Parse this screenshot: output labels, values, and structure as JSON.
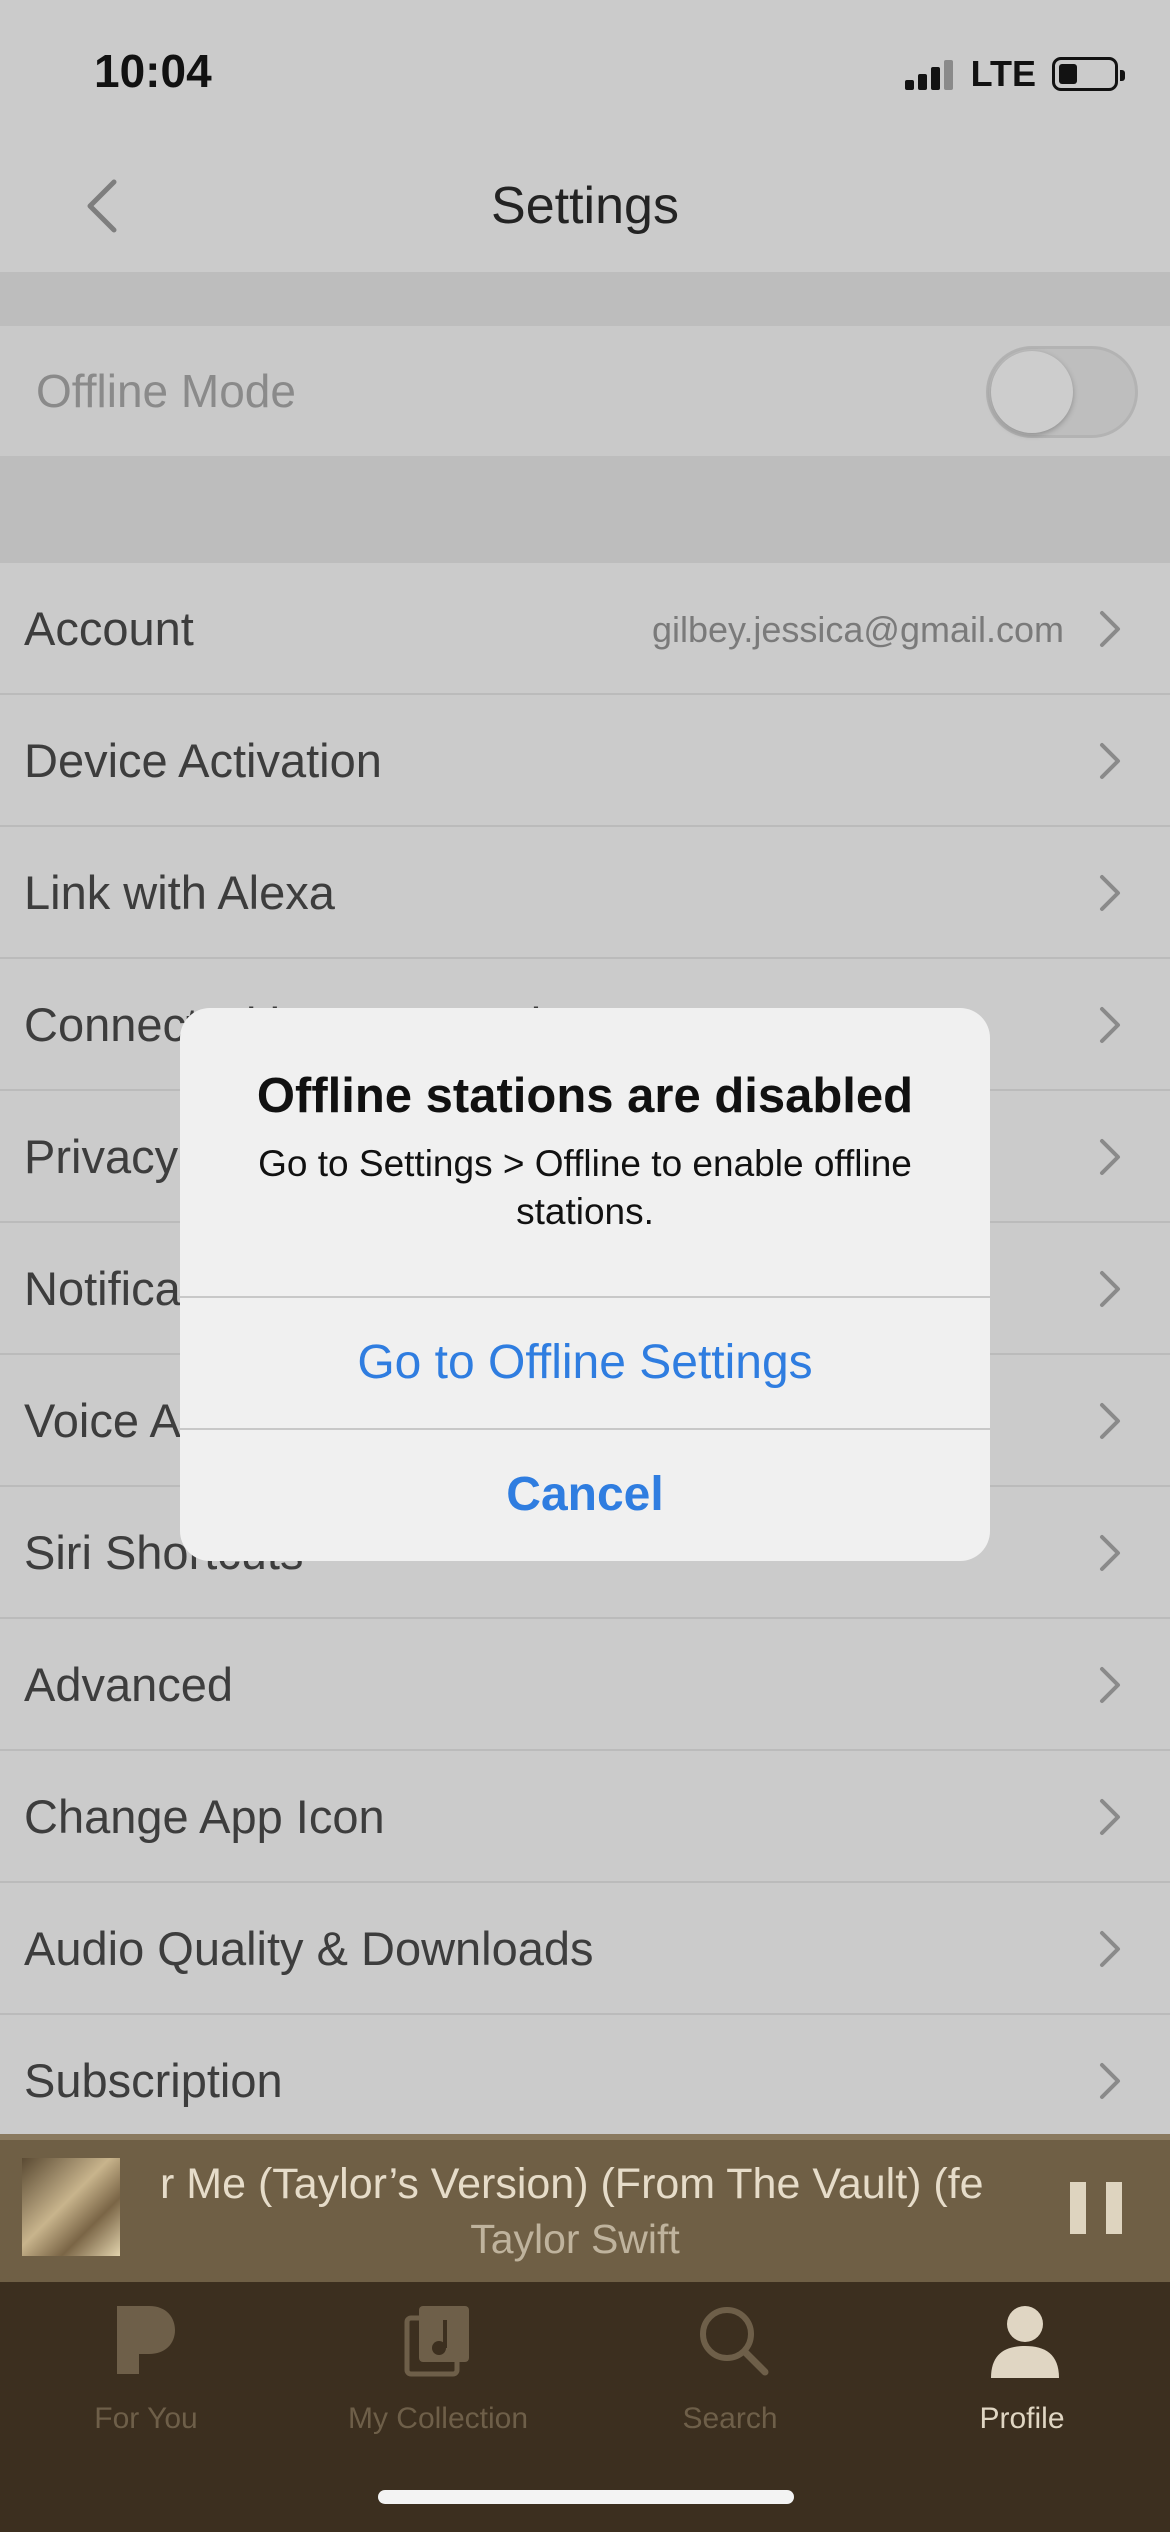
{
  "status_bar": {
    "time": "10:04",
    "network": "LTE"
  },
  "nav": {
    "title": "Settings",
    "back_icon": "chevron-left-icon"
  },
  "offline_mode": {
    "label": "Offline Mode",
    "enabled": false
  },
  "settings": {
    "items": [
      {
        "label": "Account",
        "value": "gilbey.jessica@gmail.com"
      },
      {
        "label": "Device Activation",
        "value": ""
      },
      {
        "label": "Link with Alexa",
        "value": ""
      },
      {
        "label": "Connect with Home Devices",
        "value": ""
      },
      {
        "label": "Privacy",
        "value": ""
      },
      {
        "label": "Notifications",
        "value": ""
      },
      {
        "label": "Voice Assistants",
        "value": ""
      },
      {
        "label": "Siri Shortcuts",
        "value": ""
      },
      {
        "label": "Advanced",
        "value": ""
      },
      {
        "label": "Change App Icon",
        "value": ""
      },
      {
        "label": "Audio Quality & Downloads",
        "value": ""
      },
      {
        "label": "Subscription",
        "value": ""
      }
    ]
  },
  "alert": {
    "title": "Offline stations are disabled",
    "message": "Go to Settings > Offline to enable offline stations.",
    "primary_button": "Go to Offline Settings",
    "cancel_button": "Cancel"
  },
  "now_playing": {
    "title": "r Me (Taylor’s Version) (From The Vault) (fe",
    "artist": "Taylor Swift",
    "state_icon": "pause-icon"
  },
  "tabs": [
    {
      "label": "For You",
      "icon": "pandora-p-icon",
      "active": false
    },
    {
      "label": "My Collection",
      "icon": "collection-icon",
      "active": false
    },
    {
      "label": "Search",
      "icon": "search-icon",
      "active": false
    },
    {
      "label": "Profile",
      "icon": "profile-icon",
      "active": true
    }
  ],
  "colors": {
    "accent_link": "#2f7de0",
    "player_bg": "#6f5f45",
    "tab_bar_bg": "#3c2f1f"
  }
}
